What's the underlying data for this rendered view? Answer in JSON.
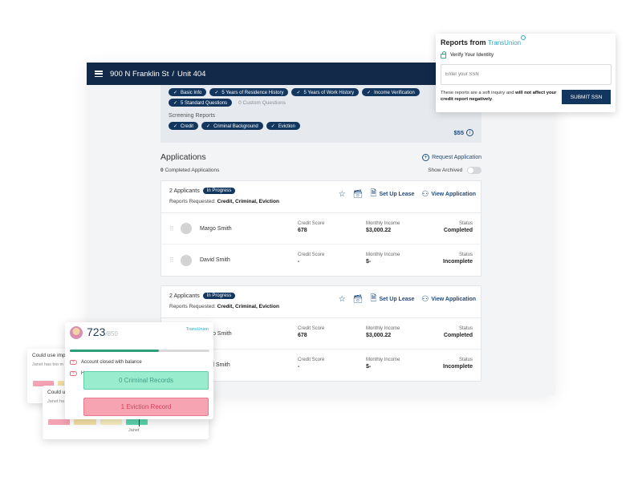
{
  "header": {
    "address": "900 N Franklin St",
    "separator": "/",
    "unit": "Unit 404"
  },
  "requested": {
    "application_chips": [
      "Basic Info",
      "5 Years of Residence History",
      "5 Years of Work History",
      "Income Verification",
      "5 Standard Questions"
    ],
    "custom_questions": "0 Custom Questions",
    "screening_label": "Screening Reports",
    "screening_chips": [
      "Credit",
      "Criminal Background",
      "Eviction"
    ],
    "price": "$55",
    "check": "✓"
  },
  "applications": {
    "title": "Applications",
    "request_label": "Request Application",
    "completed_count": "0",
    "completed_label": "Completed Applications",
    "show_archived_label": "Show Archived",
    "show_archived_on": false,
    "cards": [
      {
        "applicants_label": "2 Applicants",
        "status_badge": "In Progress",
        "reports_label": "Reports Requested:",
        "reports_value": "Credit, Criminal, Eviction",
        "set_up_lease": "Set Up Lease",
        "view_application": "View Application",
        "applicants": [
          {
            "name": "Margo Smith",
            "credit_label": "Credit Score",
            "credit": "678",
            "income_label": "Monthly Income",
            "income": "$3,000.22",
            "status_label": "Status",
            "status": "Completed"
          },
          {
            "name": "David Smith",
            "credit_label": "Credit Score",
            "credit": "-",
            "income_label": "Monthly Income",
            "income": "$-",
            "status_label": "Status",
            "status": "Incomplete"
          }
        ]
      },
      {
        "applicants_label": "2 Applicants",
        "status_badge": "In Progress",
        "reports_label": "Reports Requested:",
        "reports_value": "Credit, Criminal, Eviction",
        "set_up_lease": "Set Up Lease",
        "view_application": "View Application",
        "applicants": [
          {
            "name": "Margo Smith",
            "credit_label": "Credit Score",
            "credit": "678",
            "income_label": "Monthly Income",
            "income": "$3,000.22",
            "status_label": "Status",
            "status": "Completed"
          },
          {
            "name": "David Smith",
            "credit_label": "Credit Score",
            "credit": "-",
            "income_label": "Monthly Income",
            "income": "$-",
            "status_label": "Status",
            "status": "Incomplete"
          }
        ]
      }
    ]
  },
  "ssn_popup": {
    "title": "Reports from",
    "brand": "TransUnion",
    "verify_label": "Verify Your Identity",
    "input_placeholder": "Enter your SSN",
    "input_value": "",
    "note_plain": "These reports are a soft inquiry and ",
    "note_bold": "will not affect your credit report negatively",
    "note_end": ".",
    "submit_label": "SUBMIT SSN"
  },
  "score_card": {
    "score": "723",
    "max": "/850",
    "brand": "TransUnion",
    "progress_fraction": 0.64,
    "alerts": [
      "Account closed with balance",
      "H"
    ],
    "criminal_records": "0 Criminal Records",
    "eviction_records": "1 Eviction Record"
  },
  "insight_cards": [
    {
      "title": "Could use imp",
      "subtitle": "Janet has too m"
    },
    {
      "title": "Could u",
      "subtitle": "Janet ha",
      "marker_label": "Janet"
    }
  ],
  "colors": {
    "navy": "#12294a",
    "chip": "#12365e",
    "brand_teal": "#28a8c9",
    "criminal_bg": "#9aeccf",
    "eviction_bg": "#f6a4b2",
    "progress": "#2f9e7a"
  }
}
